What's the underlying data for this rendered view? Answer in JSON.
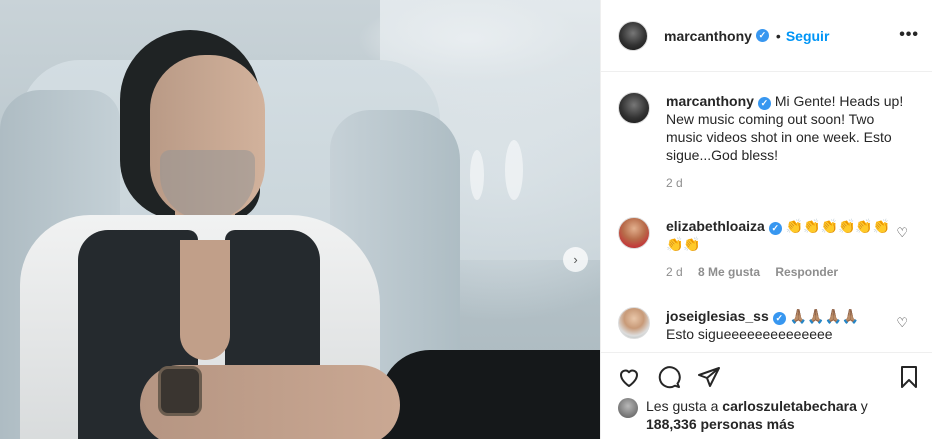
{
  "photo": {
    "next_icon": "chevron-right-icon",
    "next_glyph": "›"
  },
  "post": {
    "author": "marcanthony",
    "separator": "•",
    "follow_label": "Seguir",
    "more_glyph": "•••"
  },
  "caption": {
    "author": "marcanthony",
    "text": "Mi Gente! Heads up! New music coming out soon! Two music videos shot in one week. Esto sigue...God bless!",
    "time": "2 d"
  },
  "comments": [
    {
      "author": "elizabethloaiza",
      "text": "👏👏👏👏👏👏👏👏",
      "time": "2 d",
      "likes": "8 Me gusta",
      "reply_label": "Responder"
    },
    {
      "author": "joseiglesias_ss",
      "text": "🙏🏽🙏🏽🙏🏽🙏🏽",
      "text2": "Esto sigueeeeeeeeeeeeee"
    }
  ],
  "likes": {
    "prefix": "Les gusta a",
    "user": "carloszuletabechara",
    "connector": "y",
    "count": "188,336 personas más"
  },
  "colors": {
    "accent": "#0095f6",
    "verified": "#3897f0",
    "muted": "#8e8e8e",
    "text": "#262626"
  }
}
